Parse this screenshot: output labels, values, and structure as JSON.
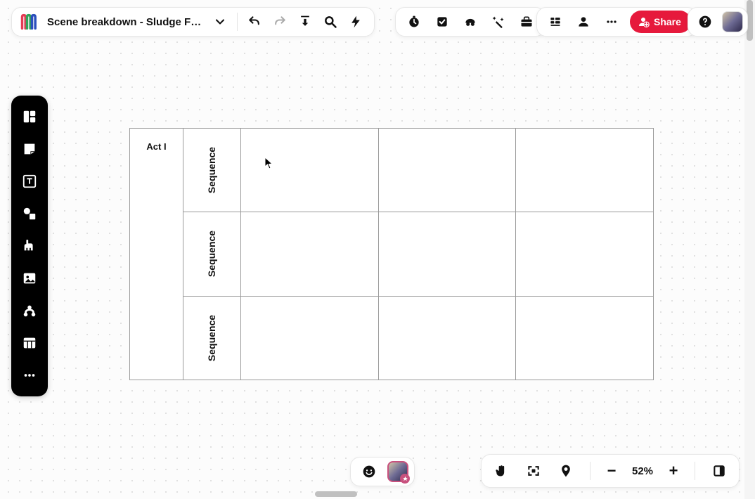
{
  "header": {
    "title": "Scene breakdown - Sludge Fashion",
    "share_label": "Share"
  },
  "board": {
    "act_label": "Act I",
    "sequences": [
      "Sequence",
      "Sequence",
      "Sequence"
    ],
    "cols": 3
  },
  "zoom": {
    "level": "52%"
  }
}
